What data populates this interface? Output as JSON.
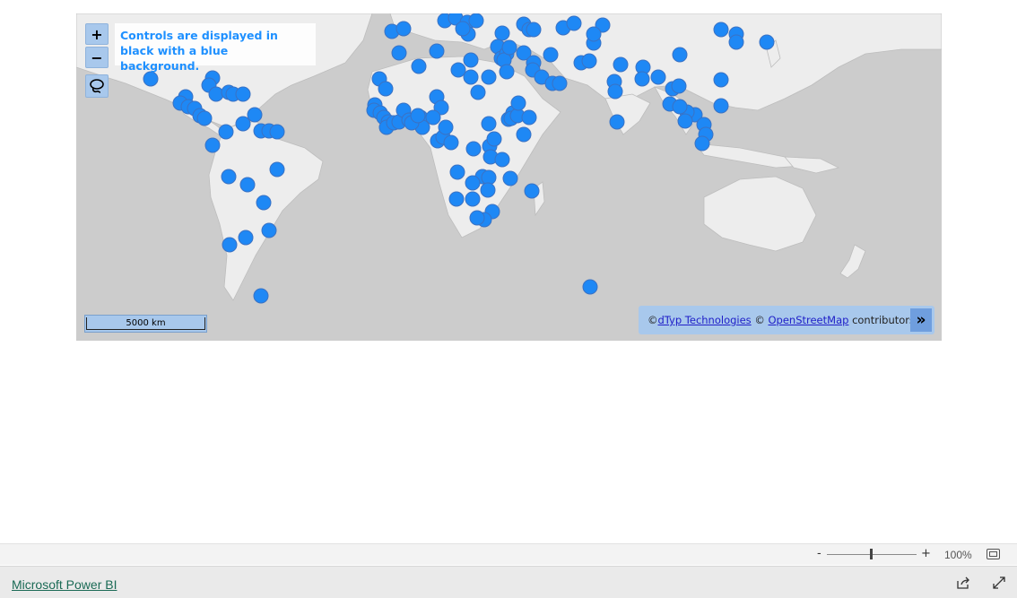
{
  "map": {
    "info_text": "Controls are displayed in black with a blue background.",
    "zoom_in_label": "+",
    "zoom_out_label": "−",
    "scale_label": "5000 km",
    "attribution": {
      "prefix": "© ",
      "link1": "dTyp Technologies",
      "middle": " © ",
      "link2": "OpenStreetMap",
      "suffix": " contributors.",
      "toggle": "»"
    },
    "icons": {
      "zoom_in": "plus-icon",
      "zoom_out": "minus-icon",
      "lasso": "lasso-icon",
      "toggle": "double-chevron-icon"
    },
    "colors": {
      "ocean": "#cccccc",
      "land": "#ededed",
      "marker": "#1e88f5",
      "control_bg": "#a8c8ec"
    }
  },
  "zoom": {
    "minus_label": "-",
    "plus_label": "+",
    "value": "100%",
    "level_fraction": 0.5
  },
  "footer": {
    "brand_link": "Microsoft Power BI",
    "icons": {
      "share": "share-icon",
      "fullscreen": "expand-icon"
    }
  }
}
